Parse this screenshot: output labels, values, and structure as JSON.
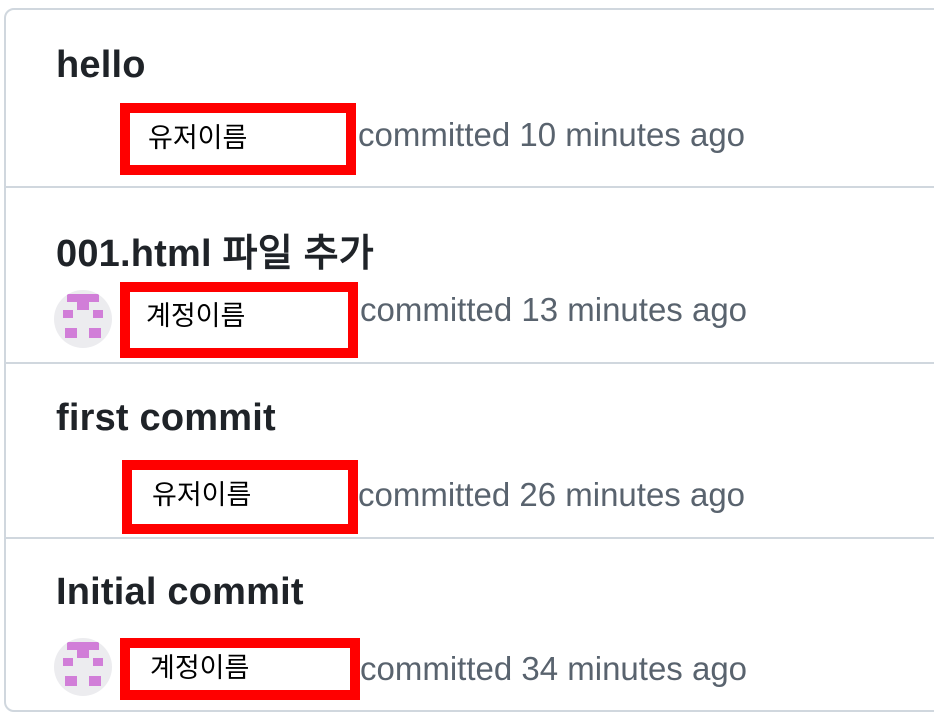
{
  "commits": [
    {
      "title": "hello",
      "author": "유저이름",
      "meta": "committed 10 minutes ago",
      "avatar": "none"
    },
    {
      "title": "001.html 파일 추가",
      "author": "계정이름",
      "meta": "committed 13 minutes ago",
      "avatar": "identicon-avatar"
    },
    {
      "title": "first commit",
      "author": "유저이름",
      "meta": "committed 26 minutes ago",
      "avatar": "none"
    },
    {
      "title": "Initial commit",
      "author": "계정이름",
      "meta": "committed 34 minutes ago",
      "avatar": "identicon-avatar"
    }
  ],
  "colors": {
    "border": "#d0d7de",
    "title": "#1f2328",
    "meta": "#59636e",
    "highlight": "#ff0000",
    "identicon": "#d17ed8"
  }
}
